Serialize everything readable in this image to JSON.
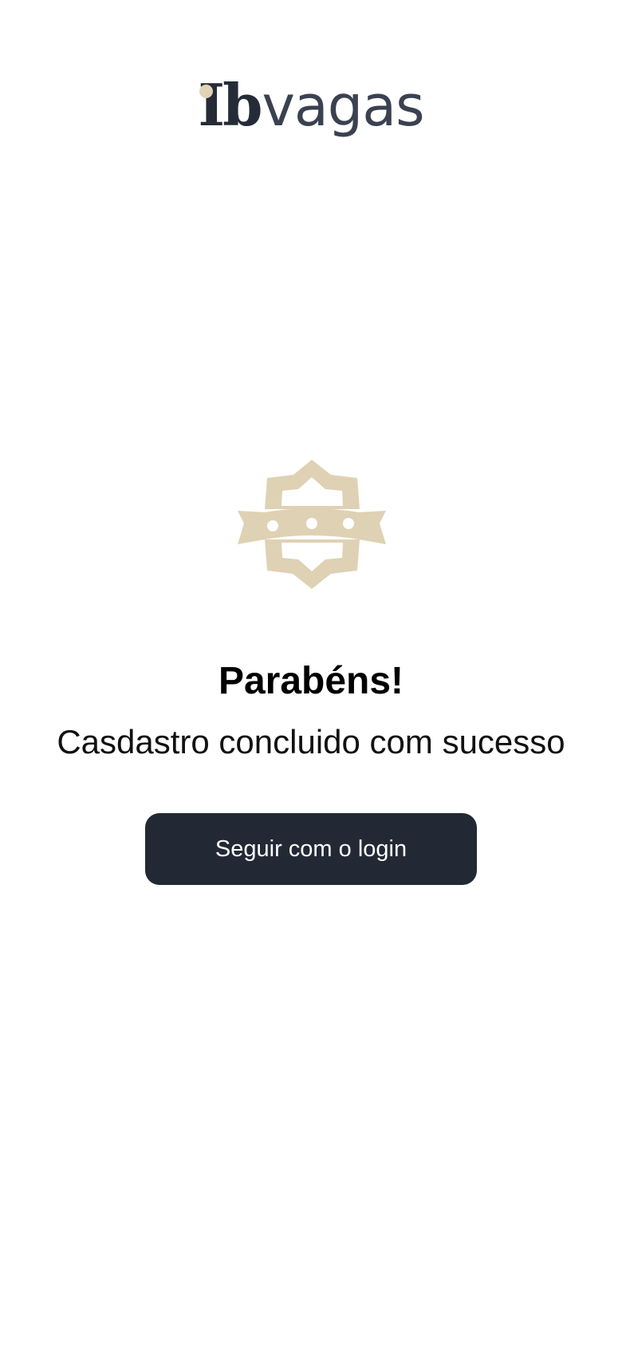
{
  "logo": {
    "mark": "Ib",
    "word": "vagas",
    "accent_color": "#e0d3b6",
    "dark_color": "#262c37"
  },
  "badge": {
    "icon": "ticket-badge-icon",
    "color": "#dfd1b4"
  },
  "message": {
    "title": "Parabéns!",
    "subtitle": "Casdastro concluido com sucesso"
  },
  "actions": {
    "login_label": "Seguir com o login",
    "button_color": "#232934"
  }
}
